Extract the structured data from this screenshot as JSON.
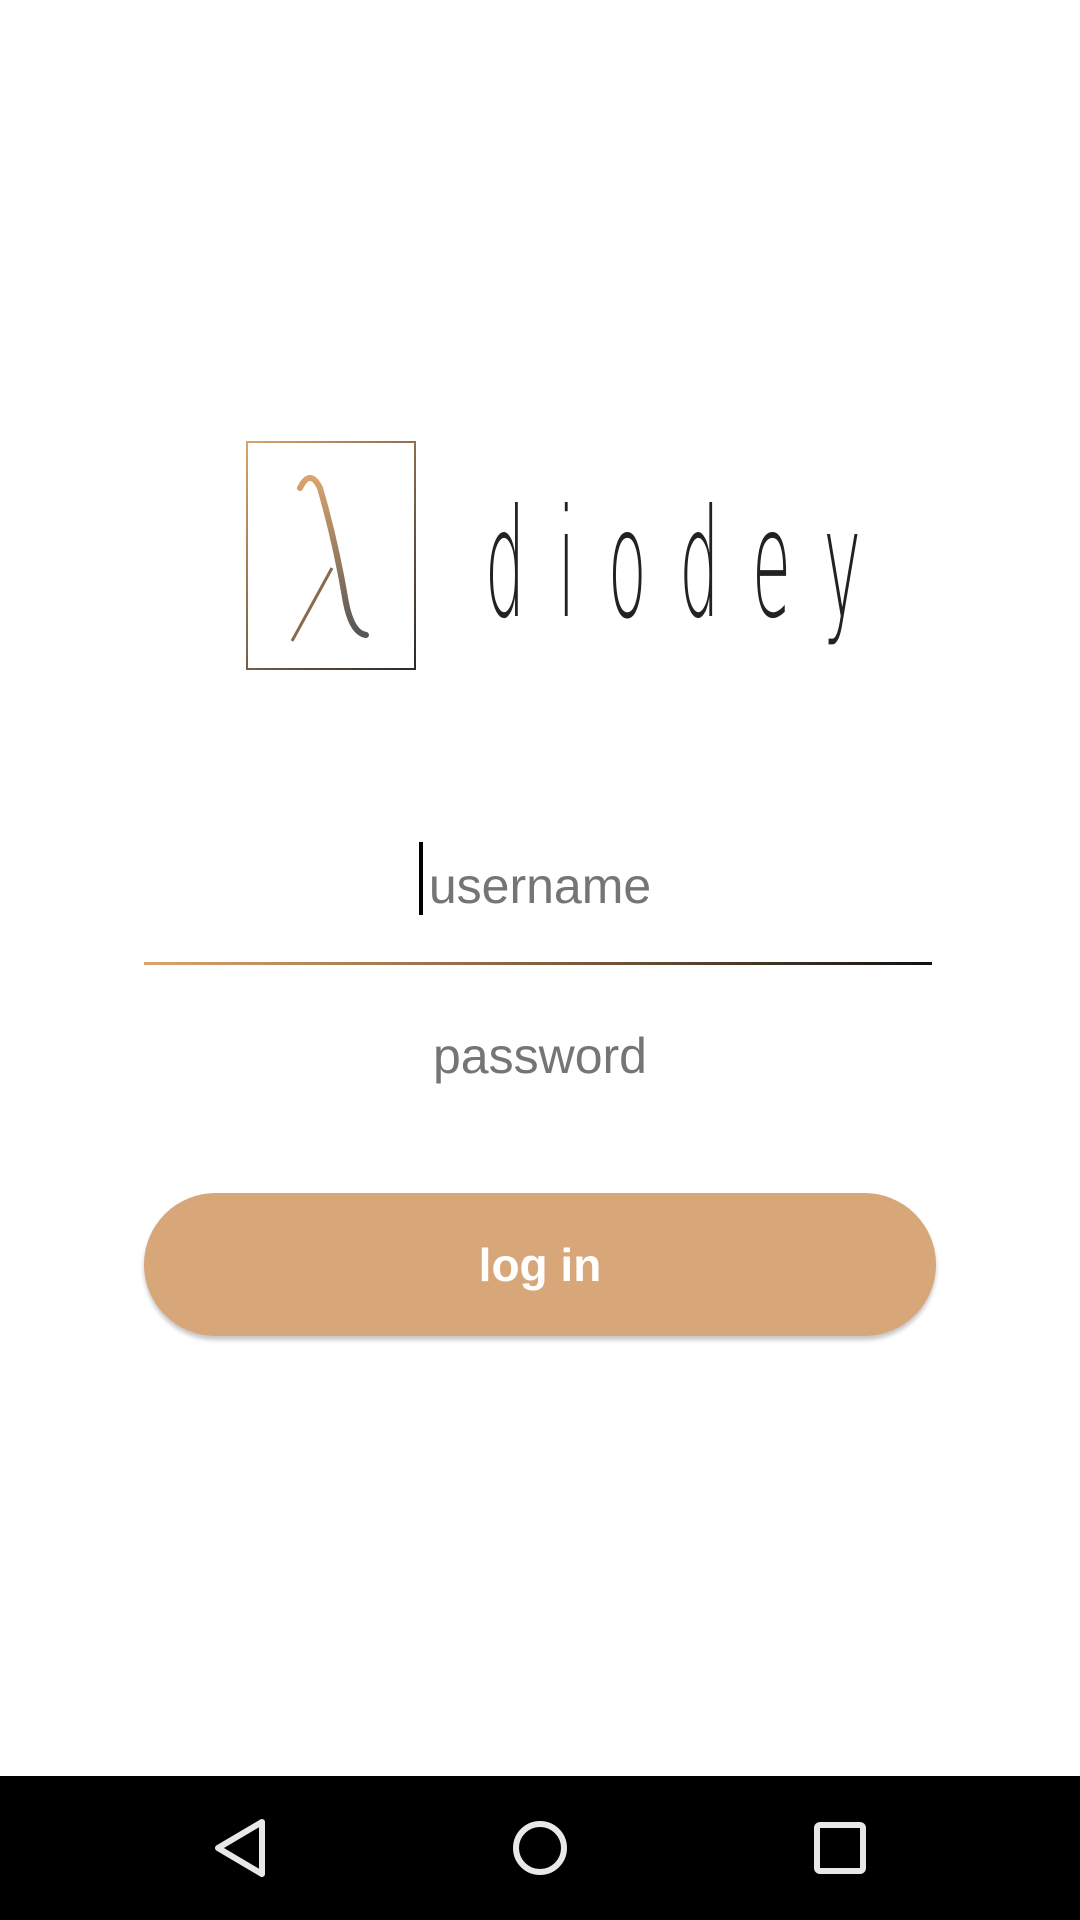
{
  "logo": {
    "symbol": "λ",
    "wordmark": "diodey"
  },
  "form": {
    "username_placeholder": "username",
    "username_value": "",
    "password_placeholder": "password",
    "password_value": "",
    "login_label": "log in"
  },
  "colors": {
    "accent": "#d8a779",
    "placeholder": "#c4c4c4",
    "navbar": "#000000"
  },
  "navbar": {
    "icons": [
      "back-icon",
      "home-icon",
      "recents-icon"
    ]
  }
}
